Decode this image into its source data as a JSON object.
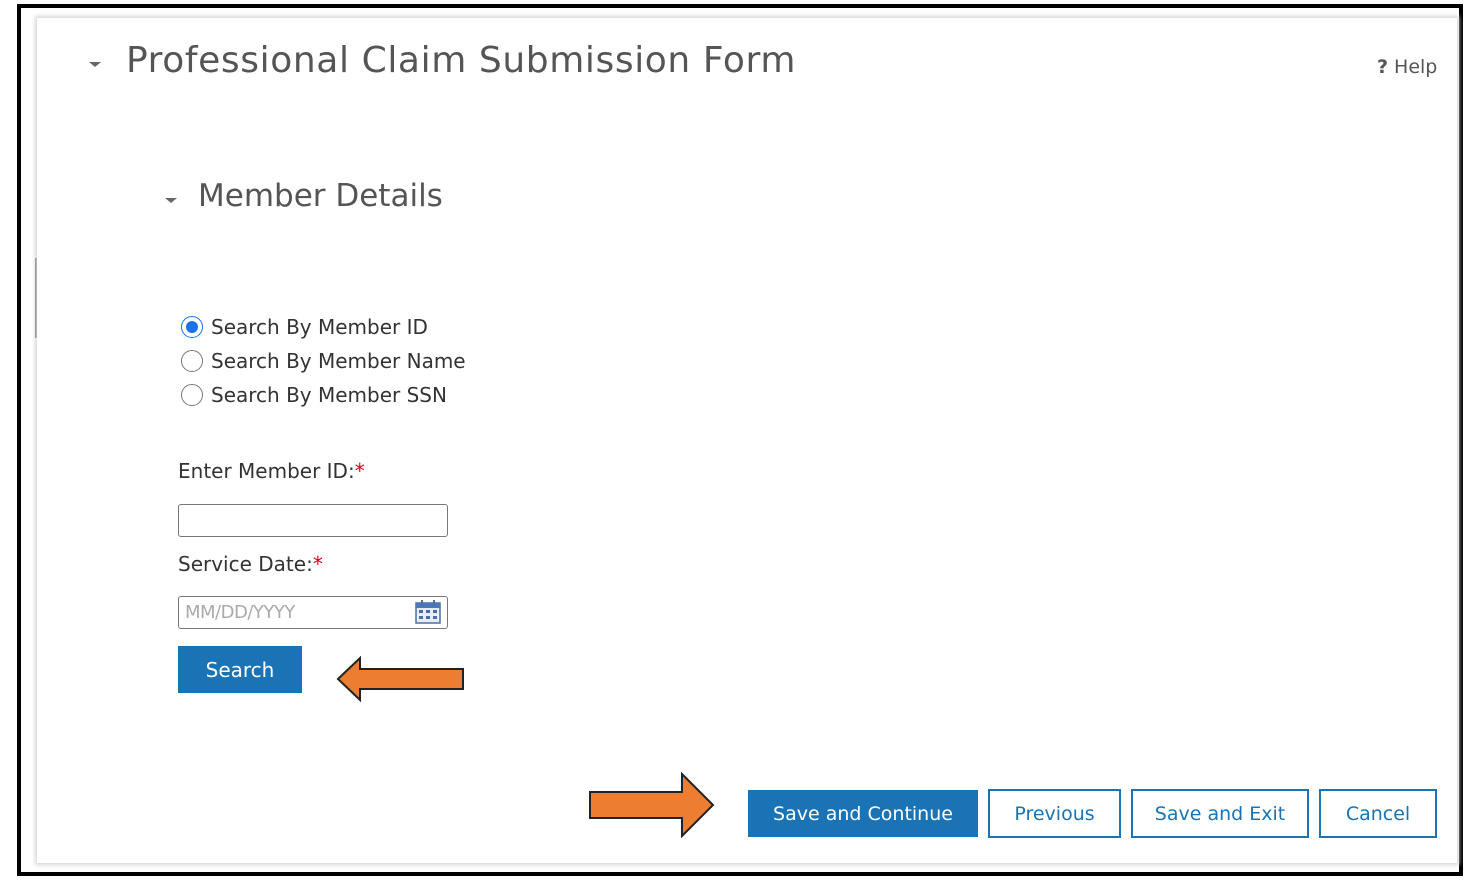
{
  "header": {
    "title": "Professional Claim Submission Form",
    "help_label": "Help",
    "help_symbol": "?"
  },
  "member_details": {
    "title": "Member Details",
    "search_options": [
      {
        "label": "Search By Member ID",
        "checked": true
      },
      {
        "label": "Search By Member Name",
        "checked": false
      },
      {
        "label": "Search By Member SSN",
        "checked": false
      }
    ],
    "member_id_label": "Enter Member ID:",
    "member_id_value": "",
    "service_date_label": "Service Date:",
    "service_date_placeholder": "MM/DD/YYYY",
    "required_marker": "*",
    "search_button": "Search"
  },
  "footer": {
    "save_continue": "Save and Continue",
    "previous": "Previous",
    "save_exit": "Save and Exit",
    "cancel": "Cancel"
  },
  "colors": {
    "primary": "#1a73b5",
    "arrow": "#ed7d31",
    "required": "#d0021b"
  }
}
